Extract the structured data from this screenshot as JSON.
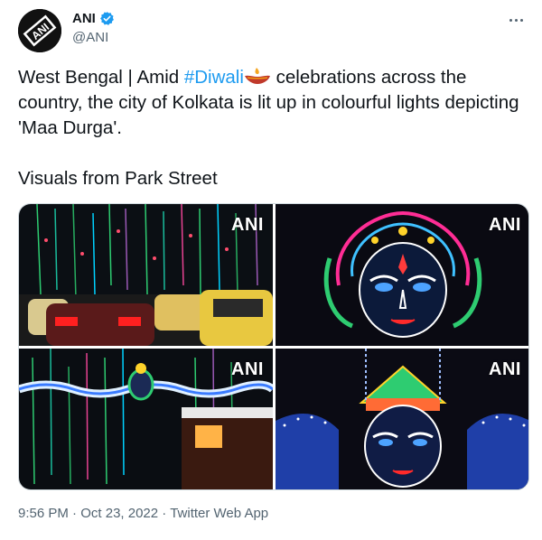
{
  "author": {
    "display_name": "ANI",
    "handle": "@ANI",
    "avatar_text": "ANI",
    "verified_icon": "verified-badge-icon"
  },
  "more_icon": "more-options-icon",
  "tweet": {
    "line1_prefix": "West Bengal | Amid ",
    "hashtag": "#Diwali",
    "emoji_icon": "diya-lamp-icon",
    "line1_suffix": " celebrations across the country, the city of Kolkata is lit up in colourful lights depicting 'Maa Durga'.",
    "line2": "Visuals from Park Street"
  },
  "media": {
    "watermark": "ANI",
    "images": [
      "street-lights-traffic-photo",
      "maa-durga-lights-closeup-photo",
      "street-lights-durga-photo",
      "durga-lights-wide-photo"
    ]
  },
  "meta": {
    "time": "9:56 PM",
    "separator": " · ",
    "date": "Oct 23, 2022",
    "source": "Twitter Web App"
  },
  "colors": {
    "hashtag": "#1d9bf0",
    "verified": "#1d9bf0",
    "secondary_text": "#536471"
  }
}
